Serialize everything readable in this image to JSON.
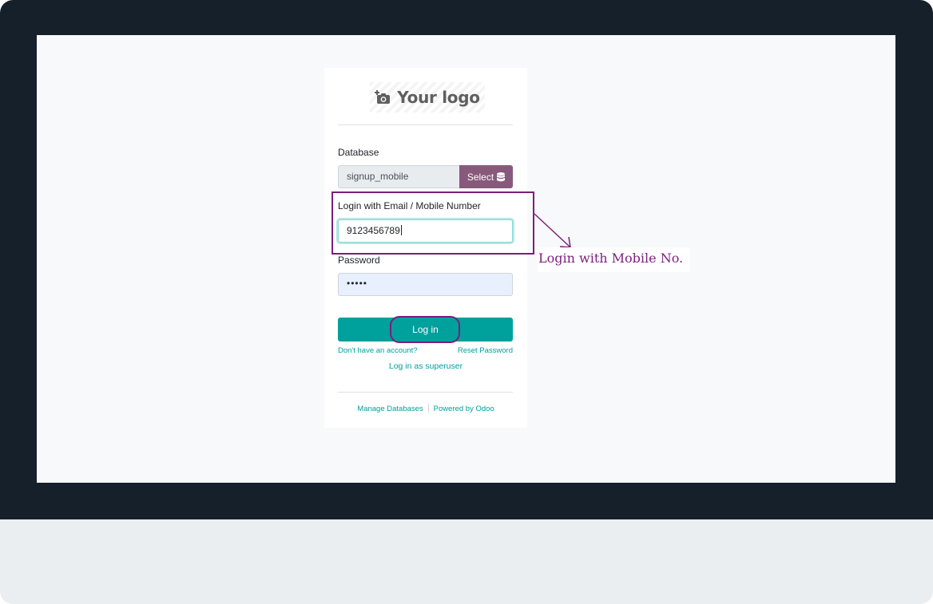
{
  "logo": {
    "text": "Your logo",
    "icon": "camera-plus-icon"
  },
  "form": {
    "database_label": "Database",
    "database_value": "signup_mobile",
    "select_button_label": "Select",
    "select_button_icon": "database-icon",
    "login_label": "Login with Email / Mobile Number",
    "login_value": "9123456789",
    "password_label": "Password",
    "password_value": "•••••",
    "login_button_label": "Log in"
  },
  "links": {
    "signup": "Don't have an account?",
    "reset_password": "Reset Password",
    "superuser": "Log in as superuser",
    "manage_databases": "Manage Databases",
    "powered_by": "Powered by Odoo"
  },
  "annotation": {
    "text": "Login with Mobile No.",
    "color": "#7b1f7b"
  },
  "colors": {
    "primary": "#00a09d",
    "select_button": "#875a7b",
    "bezel": "#15202b"
  }
}
